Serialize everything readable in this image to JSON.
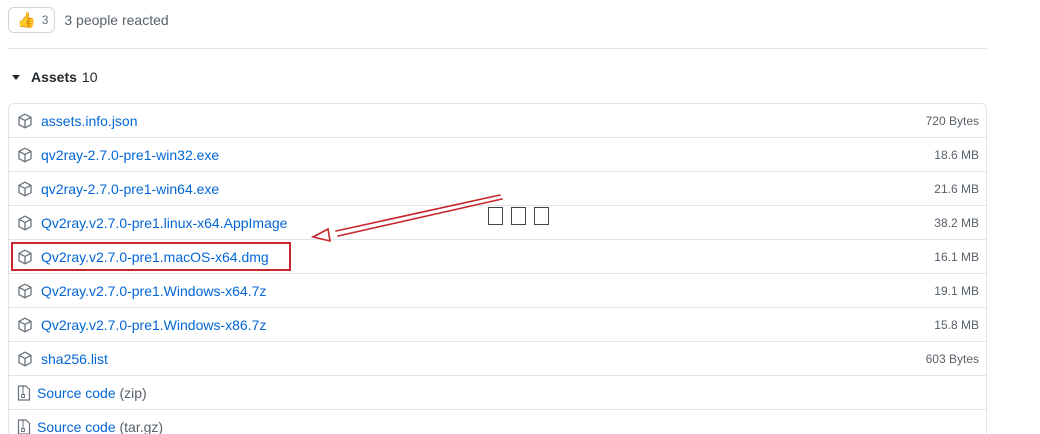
{
  "reactions": {
    "emoji": "👍",
    "count": "3",
    "text": "3 people reacted"
  },
  "assets": {
    "title": "Assets",
    "count": "10",
    "items": [
      {
        "name": "assets.info.json",
        "size": "720 Bytes"
      },
      {
        "name": "qv2ray-2.7.0-pre1-win32.exe",
        "size": "18.6 MB"
      },
      {
        "name": "qv2ray-2.7.0-pre1-win64.exe",
        "size": "21.6 MB"
      },
      {
        "name": "Qv2ray.v2.7.0-pre1.linux-x64.AppImage",
        "size": "38.2 MB"
      },
      {
        "name": "Qv2ray.v2.7.0-pre1.macOS-x64.dmg",
        "size": "16.1 MB"
      },
      {
        "name": "Qv2ray.v2.7.0-pre1.Windows-x64.7z",
        "size": "19.1 MB"
      },
      {
        "name": "Qv2ray.v2.7.0-pre1.Windows-x86.7z",
        "size": "15.8 MB"
      },
      {
        "name": "sha256.list",
        "size": "603 Bytes"
      }
    ],
    "source": [
      {
        "label": "Source code",
        "format": "(zip)"
      },
      {
        "label": "Source code",
        "format": "(tar.gz)"
      }
    ]
  },
  "annotation": {
    "color": "#c8262c",
    "highlighted_item": "Qv2ray.v2.7.0-pre1.macOS-x64.dmg"
  },
  "icons": {
    "asset": "package-icon",
    "source": "file-zip-icon"
  }
}
